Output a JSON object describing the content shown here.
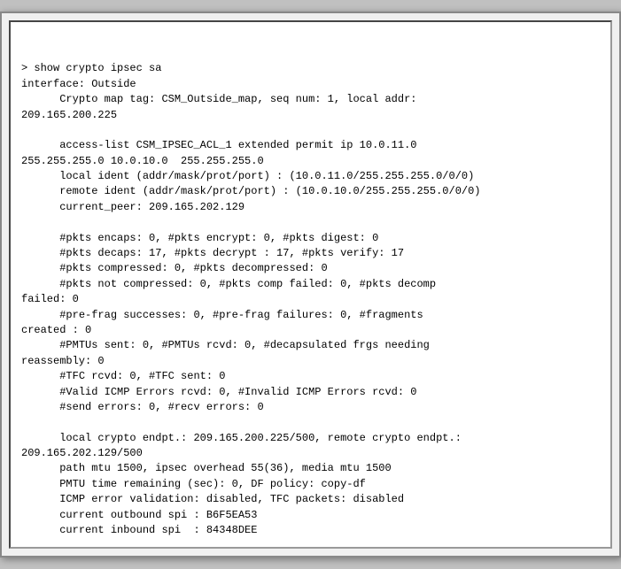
{
  "terminal": {
    "lines": [
      "> show crypto ipsec sa",
      "interface: Outside",
      "      Crypto map tag: CSM_Outside_map, seq num: 1, local addr:",
      "209.165.200.225",
      "",
      "      access-list CSM_IPSEC_ACL_1 extended permit ip 10.0.11.0",
      "255.255.255.0 10.0.10.0  255.255.255.0",
      "      local ident (addr/mask/prot/port) : (10.0.11.0/255.255.255.0/0/0)",
      "      remote ident (addr/mask/prot/port) : (10.0.10.0/255.255.255.0/0/0)",
      "      current_peer: 209.165.202.129",
      "",
      "      #pkts encaps: 0, #pkts encrypt: 0, #pkts digest: 0",
      "      #pkts decaps: 17, #pkts decrypt : 17, #pkts verify: 17",
      "      #pkts compressed: 0, #pkts decompressed: 0",
      "      #pkts not compressed: 0, #pkts comp failed: 0, #pkts decomp",
      "failed: 0",
      "      #pre-frag successes: 0, #pre-frag failures: 0, #fragments",
      "created : 0",
      "      #PMTUs sent: 0, #PMTUs rcvd: 0, #decapsulated frgs needing",
      "reassembly: 0",
      "      #TFC rcvd: 0, #TFC sent: 0",
      "      #Valid ICMP Errors rcvd: 0, #Invalid ICMP Errors rcvd: 0",
      "      #send errors: 0, #recv errors: 0",
      "",
      "      local crypto endpt.: 209.165.200.225/500, remote crypto endpt.:",
      "209.165.202.129/500",
      "      path mtu 1500, ipsec overhead 55(36), media mtu 1500",
      "      PMTU time remaining (sec): 0, DF policy: copy-df",
      "      ICMP error validation: disabled, TFC packets: disabled",
      "      current outbound spi : B6F5EA53",
      "      current inbound spi  : 84348DEE"
    ]
  }
}
